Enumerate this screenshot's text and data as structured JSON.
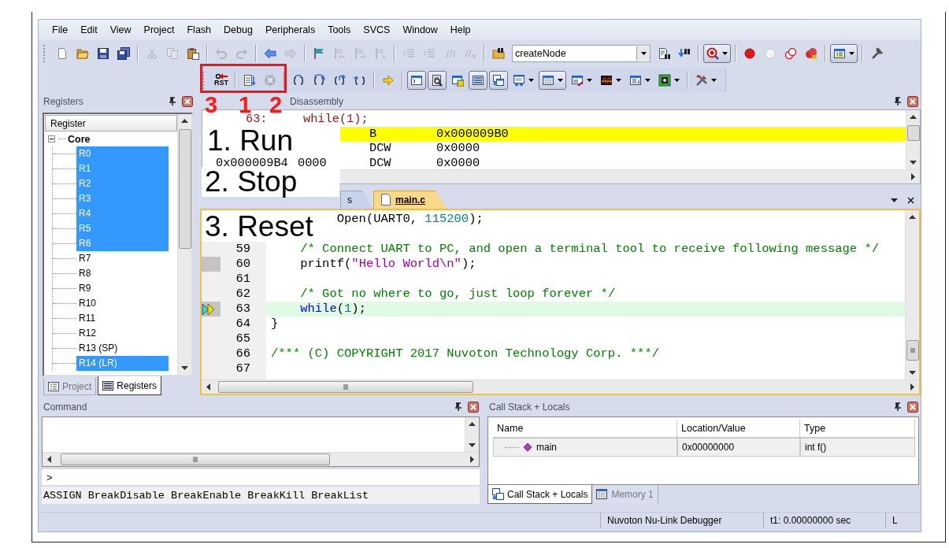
{
  "menu": [
    "File",
    "Edit",
    "View",
    "Project",
    "Flash",
    "Debug",
    "Peripherals",
    "Tools",
    "SVCS",
    "Window",
    "Help"
  ],
  "toolbar_1": {
    "groups": [
      [
        {
          "kind": "new",
          "disabled": false,
          "pressed": false
        },
        {
          "kind": "open",
          "disabled": false,
          "pressed": false
        },
        {
          "kind": "save",
          "disabled": false,
          "pressed": false
        },
        {
          "kind": "save-all",
          "disabled": false,
          "pressed": false
        }
      ],
      [
        {
          "kind": "cut",
          "disabled": true,
          "pressed": false
        },
        {
          "kind": "copy",
          "disabled": true,
          "pressed": false
        },
        {
          "kind": "paste",
          "disabled": false,
          "pressed": false
        }
      ],
      [
        {
          "kind": "undo",
          "disabled": true,
          "pressed": false
        },
        {
          "kind": "redo",
          "disabled": true,
          "pressed": false
        }
      ],
      [
        {
          "kind": "back",
          "disabled": false,
          "pressed": false
        },
        {
          "kind": "forward",
          "disabled": true,
          "pressed": false
        }
      ],
      [
        {
          "kind": "bookmark",
          "disabled": false,
          "pressed": false
        },
        {
          "kind": "bookmark-prev",
          "disabled": true,
          "pressed": false
        },
        {
          "kind": "bookmark-next",
          "disabled": true,
          "pressed": false
        },
        {
          "kind": "bookmark-clear",
          "disabled": true,
          "pressed": false
        }
      ],
      [
        {
          "kind": "indent",
          "disabled": true,
          "pressed": false
        },
        {
          "kind": "outdent",
          "disabled": true,
          "pressed": false
        },
        {
          "kind": "comment",
          "disabled": true,
          "pressed": false
        },
        {
          "kind": "uncomment",
          "disabled": true,
          "pressed": false
        }
      ],
      [
        {
          "kind": "find-in-files",
          "disabled": false,
          "pressed": false
        },
        {
          "kind": "combo",
          "value": "createNode",
          "disabled": false,
          "pressed": false
        },
        {
          "kind": "find",
          "disabled": false,
          "pressed": false
        },
        {
          "kind": "incremental-find",
          "disabled": false,
          "pressed": false
        }
      ],
      [
        {
          "kind": "debug",
          "disabled": false,
          "pressed": true
        }
      ],
      [
        {
          "kind": "breakpoint",
          "disabled": false,
          "pressed": false
        },
        {
          "kind": "breakpoint-toggle",
          "disabled": false,
          "pressed": false
        },
        {
          "kind": "breakpoints-disable",
          "disabled": false,
          "pressed": false
        },
        {
          "kind": "breakpoints-kill",
          "disabled": false,
          "pressed": false
        }
      ],
      [
        {
          "kind": "window",
          "disabled": false,
          "pressed": true
        }
      ],
      [
        {
          "kind": "configure",
          "disabled": false,
          "pressed": false
        }
      ]
    ]
  },
  "toolbar_2": {
    "groups": [
      [
        {
          "kind": "reset",
          "label": "RST",
          "disabled": false,
          "pressed": false
        }
      ],
      [
        {
          "kind": "run",
          "disabled": false,
          "pressed": false
        },
        {
          "kind": "stop",
          "disabled": true,
          "pressed": false
        }
      ],
      [
        {
          "kind": "step-into",
          "disabled": false,
          "pressed": false
        },
        {
          "kind": "step-over",
          "disabled": false,
          "pressed": false
        },
        {
          "kind": "step-out",
          "disabled": false,
          "pressed": false
        },
        {
          "kind": "run-to-cursor",
          "disabled": false,
          "pressed": false
        }
      ],
      [
        {
          "kind": "show-next",
          "disabled": false,
          "pressed": false
        }
      ],
      [
        {
          "kind": "command-window",
          "disabled": false,
          "pressed": true
        },
        {
          "kind": "disassembly-window",
          "disabled": false,
          "pressed": true
        },
        {
          "kind": "symbols-window",
          "disabled": false,
          "pressed": false
        },
        {
          "kind": "registers-window",
          "disabled": false,
          "pressed": true
        },
        {
          "kind": "call-stack-window",
          "disabled": false,
          "pressed": true
        },
        {
          "kind": "watch-windows",
          "disabled": false,
          "pressed": false
        },
        {
          "kind": "memory-windows",
          "disabled": false,
          "pressed": true
        },
        {
          "kind": "serial-windows",
          "disabled": false,
          "pressed": false
        },
        {
          "kind": "analysis-windows",
          "disabled": false,
          "pressed": false
        },
        {
          "kind": "trace-windows",
          "disabled": false,
          "pressed": false
        },
        {
          "kind": "system-viewer",
          "disabled": false,
          "pressed": false
        }
      ],
      [
        {
          "kind": "toolbox",
          "disabled": false,
          "pressed": false
        }
      ]
    ]
  },
  "registers_panel": {
    "title": "Registers",
    "column": "Register",
    "tree": [
      {
        "label": "Core",
        "expanded": true,
        "children": [
          {
            "label": "R0",
            "selected": true
          },
          {
            "label": "R1",
            "selected": true
          },
          {
            "label": "R2",
            "selected": true
          },
          {
            "label": "R3",
            "selected": true
          },
          {
            "label": "R4",
            "selected": true
          },
          {
            "label": "R5",
            "selected": true
          },
          {
            "label": "R6",
            "selected": true
          },
          {
            "label": "R7",
            "selected": false
          },
          {
            "label": "R8",
            "selected": false
          },
          {
            "label": "R9",
            "selected": false
          },
          {
            "label": "R10",
            "selected": false
          },
          {
            "label": "R11",
            "selected": false
          },
          {
            "label": "R12",
            "selected": false
          },
          {
            "label": "R13 (SP)",
            "selected": false
          },
          {
            "label": "R14 (LR)",
            "selected": true
          }
        ]
      }
    ],
    "tabs": [
      {
        "label": "Project",
        "selected": false
      },
      {
        "label": "Registers",
        "selected": true
      }
    ]
  },
  "disassembly": {
    "title": "Disassembly",
    "lines": [
      {
        "kind": "source",
        "number": "63:",
        "text": "while(1);",
        "current": false
      },
      {
        "kind": "instruction",
        "mnemonic": "B",
        "operand": "0x000009B0",
        "current": true
      },
      {
        "kind": "instruction",
        "mnemonic": "DCW",
        "operand": "0x0000",
        "current": false
      },
      {
        "kind": "instruction",
        "address": "0x000009B4",
        "opcode": "0000",
        "mnemonic": "DCW",
        "operand": "0x0000",
        "current": false
      }
    ]
  },
  "editor": {
    "tabs": [
      {
        "label": "s",
        "selected": false
      },
      {
        "label": "main.c",
        "selected": true
      }
    ],
    "lines": [
      {
        "kind": "partial",
        "parts": [
          {
            "kind": "plain",
            "text": "         Open(UART0, "
          },
          {
            "kind": "number",
            "text": "115200"
          },
          {
            "kind": "plain",
            "text": ");"
          }
        ]
      },
      {
        "kind": "covered"
      },
      {
        "kind": "code",
        "number": "59",
        "executable": false,
        "current": false,
        "parts": [
          {
            "kind": "comment",
            "text": "    /* Connect UART to PC, and open a terminal tool to receive following message */"
          }
        ]
      },
      {
        "kind": "code",
        "number": "60",
        "executable": true,
        "current": false,
        "parts": [
          {
            "kind": "plain",
            "text": "    printf("
          },
          {
            "kind": "string",
            "text": "\"Hello World\\n\""
          },
          {
            "kind": "plain",
            "text": ");"
          }
        ]
      },
      {
        "kind": "code",
        "number": "61",
        "executable": false,
        "current": false
      },
      {
        "kind": "code",
        "number": "62",
        "executable": false,
        "current": false,
        "parts": [
          {
            "kind": "comment",
            "text": "    /* Got no where to go, just loop forever */"
          }
        ]
      },
      {
        "kind": "code",
        "number": "63",
        "executable": true,
        "current": true,
        "parts": [
          {
            "kind": "keyword",
            "text": "    while"
          },
          {
            "kind": "plain",
            "text": "("
          },
          {
            "kind": "number",
            "text": "1"
          },
          {
            "kind": "plain",
            "text": ");"
          }
        ]
      },
      {
        "kind": "code",
        "number": "64",
        "executable": false,
        "current": false,
        "parts": [
          {
            "kind": "plain",
            "text": "}"
          }
        ]
      },
      {
        "kind": "code",
        "number": "65",
        "executable": false,
        "current": false
      },
      {
        "kind": "code",
        "number": "66",
        "executable": false,
        "current": false,
        "parts": [
          {
            "kind": "comment",
            "text": "/*** (C) COPYRIGHT 2017 Nuvoton Technology Corp. ***/"
          }
        ]
      },
      {
        "kind": "code",
        "number": "67",
        "executable": false,
        "current": false
      }
    ]
  },
  "command": {
    "title": "Command",
    "prompt": ">",
    "hint": "ASSIGN BreakDisable BreakEnable BreakKill BreakList"
  },
  "call_stack": {
    "title": "Call Stack + Locals",
    "columns": [
      "Name",
      "Location/Value",
      "Type"
    ],
    "rows": [
      {
        "name": "main",
        "value": "0x00000000",
        "type": "int f()"
      }
    ],
    "tabs": [
      {
        "label": "Call Stack + Locals",
        "selected": true
      },
      {
        "label": "Memory 1",
        "selected": false
      }
    ]
  },
  "status_bar": [
    "Nuvoton Nu-Link Debugger",
    "t1: 0.00000000 sec",
    "L"
  ],
  "annotations": {
    "numbers": [
      "3",
      "1",
      "2"
    ],
    "labels": [
      "1. Run",
      "2. Stop",
      "3. Reset"
    ]
  }
}
